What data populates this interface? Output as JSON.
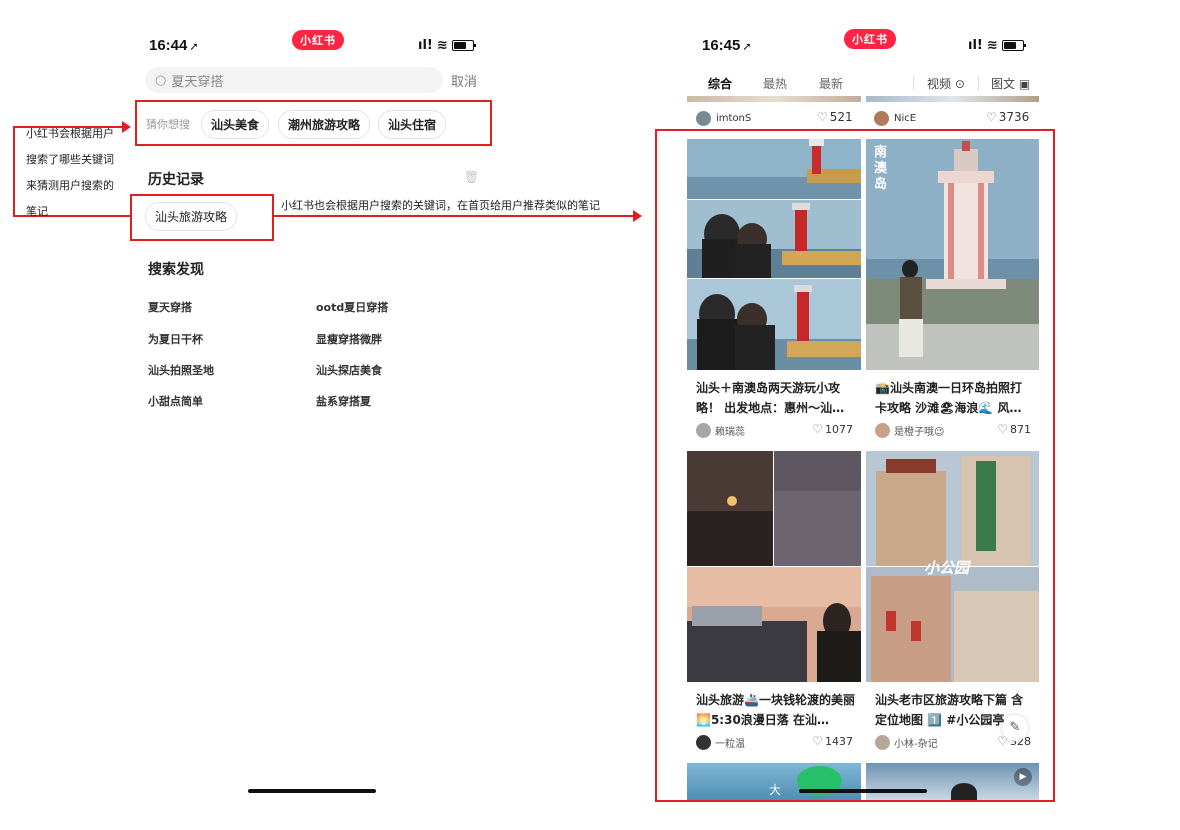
{
  "left_phone": {
    "status_time": "16:44",
    "logo": "小红书",
    "search_placeholder": "夏天穿搭",
    "cancel_label": "取消",
    "guess_label": "猜你想搜",
    "guess_chips": [
      "汕头美食",
      "潮州旅游攻略",
      "汕头住宿"
    ],
    "history_title": "历史记录",
    "history_items": [
      "汕头旅游攻略"
    ],
    "discover_title": "搜索发现",
    "discover_items": [
      "夏天穿搭",
      "ootd夏日穿搭",
      "为夏日干杯",
      "显瘦穿搭微胖",
      "汕头拍照圣地",
      "汕头探店美食",
      "小甜点简单",
      "盐系穿搭夏"
    ]
  },
  "annotations": {
    "left_note_lines": [
      "小红书会根据用户",
      "搜索了哪些关键词",
      "来猜测用户搜索的",
      "笔记"
    ],
    "middle_note": "小红书也会根据用户搜索的关键词，在首页给用户推荐类似的笔记"
  },
  "right_phone": {
    "status_time": "16:45",
    "logo": "小红书",
    "tabs": [
      "综合",
      "最热",
      "最新"
    ],
    "tab_video": "视频",
    "tab_image_text": "图文",
    "top_row": [
      {
        "author": "imtonS",
        "likes": "521"
      },
      {
        "author": "NicE",
        "likes": "3736"
      }
    ],
    "cards": [
      {
        "title": "汕头＋南澳岛两天游玩小攻略！ 出发地点：惠州～汕…",
        "author": "赖瑞蕊",
        "likes": "1077"
      },
      {
        "title": "📸汕头南澳一日环岛拍照打卡攻略 沙滩🏖海浪🌊 风…",
        "author": "是橙子哦😉",
        "likes": "871"
      },
      {
        "title": "汕头旅游🚢一块钱轮渡的美丽🌅5:30浪漫日落 在汕…",
        "author": "一粒温",
        "likes": "1437"
      },
      {
        "title": "汕头老市区旅游攻略下篇 含定位地图 1️⃣ #小公园亭",
        "author": "小林-杂记",
        "likes": "328"
      }
    ],
    "img_overlay_nanao": "南澳岛",
    "img_overlay_park": "小公园",
    "bottom_overlay_char": "大"
  },
  "colors": {
    "accent_red": "#ff2442",
    "annotation_red": "#e02020"
  }
}
